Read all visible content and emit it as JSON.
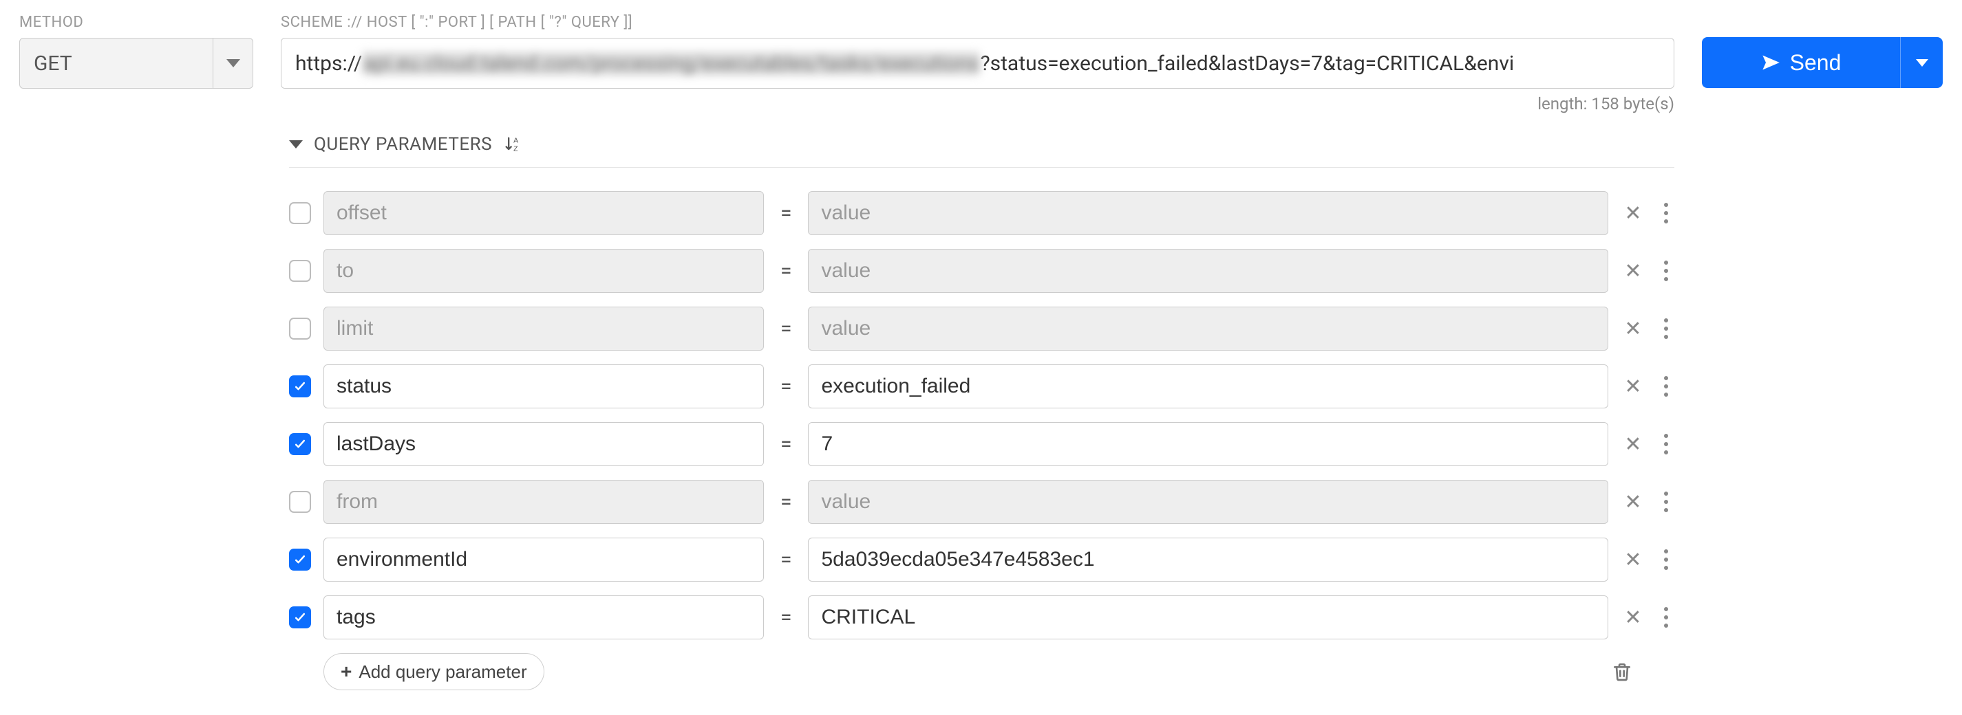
{
  "labels": {
    "method": "METHOD",
    "url": "SCHEME :// HOST [ \":\" PORT ] [ PATH [ \"?\" QUERY ]]",
    "send": "Send",
    "query_params": "QUERY PARAMETERS",
    "add_param": "Add query parameter",
    "length_note": "length: 158 byte(s)",
    "value_placeholder": "value"
  },
  "method": "GET",
  "url": {
    "prefix": "https://",
    "blurred": "api.eu.cloud.talend.com/processing/executables/tasks/executions",
    "suffix": "?status=execution_failed&lastDays=7&tag=CRITICAL&envi"
  },
  "params": [
    {
      "enabled": false,
      "name": "offset",
      "value": ""
    },
    {
      "enabled": false,
      "name": "to",
      "value": ""
    },
    {
      "enabled": false,
      "name": "limit",
      "value": ""
    },
    {
      "enabled": true,
      "name": "status",
      "value": "execution_failed"
    },
    {
      "enabled": true,
      "name": "lastDays",
      "value": "7"
    },
    {
      "enabled": false,
      "name": "from",
      "value": ""
    },
    {
      "enabled": true,
      "name": "environmentId",
      "value": "5da039ecda05e347e4583ec1"
    },
    {
      "enabled": true,
      "name": "tags",
      "value": "CRITICAL"
    }
  ]
}
